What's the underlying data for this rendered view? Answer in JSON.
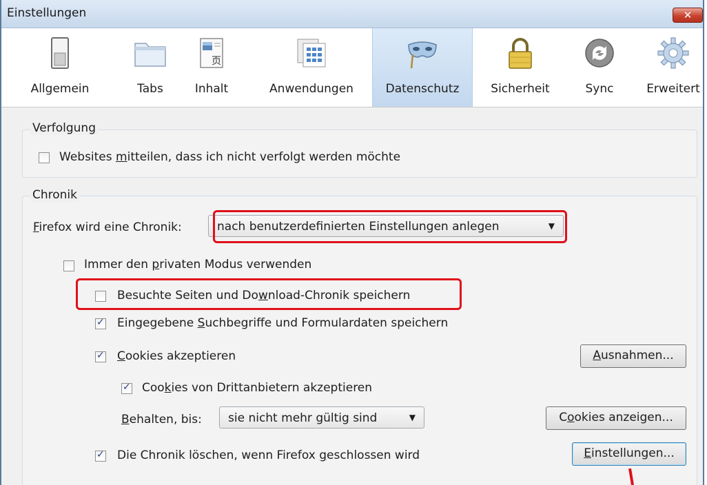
{
  "window": {
    "title": "Einstellungen",
    "close_symbol": "✕"
  },
  "toolbar": {
    "items": [
      {
        "label": "Allgemein",
        "icon": "general-switch-icon"
      },
      {
        "label": "Tabs",
        "icon": "tabs-folder-icon"
      },
      {
        "label": "Inhalt",
        "icon": "content-page-icon"
      },
      {
        "label": "Anwendungen",
        "icon": "applications-icon"
      },
      {
        "label": "Datenschutz",
        "icon": "privacy-mask-icon",
        "selected": true
      },
      {
        "label": "Sicherheit",
        "icon": "security-lock-icon"
      },
      {
        "label": "Sync",
        "icon": "sync-icon"
      },
      {
        "label": "Erweitert",
        "icon": "advanced-gear-icon"
      }
    ]
  },
  "tracking": {
    "legend": "Verfolgung",
    "dnt_pre": "Websites ",
    "dnt_u": "m",
    "dnt_post": "itteilen, dass ich nicht verfolgt werden möchte",
    "dnt_checked": false
  },
  "history": {
    "legend": "Chronik",
    "mode_label_u": "F",
    "mode_label_rest": "irefox wird eine Chronik:",
    "mode_value": "nach benutzerdefinierten Einstellungen anlegen",
    "private_pre": "Immer den ",
    "private_u": "p",
    "private_post": "rivaten Modus verwenden",
    "private_checked": false,
    "visited_pre": "Besuchte Seiten und Do",
    "visited_u": "w",
    "visited_post": "nload-Chronik speichern",
    "visited_checked": false,
    "search_pre": "Eingegebene ",
    "search_u": "S",
    "search_post": "uchbegriffe und Formulardaten speichern",
    "search_checked": true,
    "cookies_u": "C",
    "cookies_post": "ookies akzeptieren",
    "cookies_checked": true,
    "exceptions_u": "A",
    "exceptions_post": "usnahmen...",
    "third_pre": "Coo",
    "third_u": "k",
    "third_post": "ies von Drittanbietern akzeptieren",
    "third_checked": true,
    "keep_u": "B",
    "keep_post": "ehalten, bis:",
    "keep_value": "sie nicht mehr gültig sind",
    "show_cookies_pre": "C",
    "show_cookies_u": "o",
    "show_cookies_post": "okies anzeigen...",
    "clear_pre": "Die Chronik löschen, wenn Firefox ",
    "clear_u": "g",
    "clear_post": "eschlossen wird",
    "clear_checked": true,
    "settings_u": "E",
    "settings_post": "instellungen..."
  },
  "colors": {
    "highlight": "#e0101a",
    "selected_tab": "#c3d8ef",
    "close_button": "#c9432f"
  }
}
